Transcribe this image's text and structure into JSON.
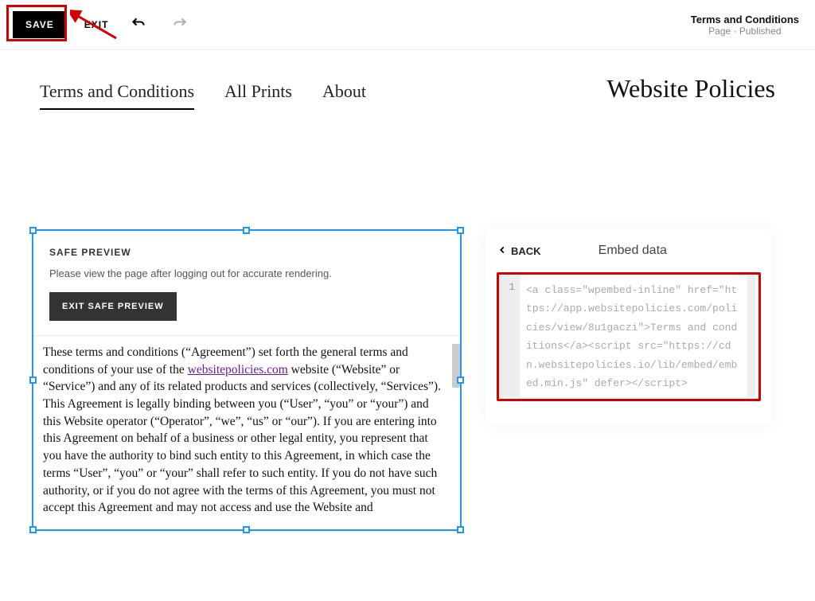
{
  "topbar": {
    "save_label": "SAVE",
    "exit_label": "EXIT",
    "doc_title": "Terms and Conditions",
    "doc_status": "Page · Published"
  },
  "nav": {
    "tabs": [
      {
        "label": "Terms and Conditions",
        "active": true
      },
      {
        "label": "All Prints",
        "active": false
      },
      {
        "label": "About",
        "active": false
      }
    ],
    "site_title": "Website Policies"
  },
  "preview": {
    "safe_title": "SAFE PREVIEW",
    "safe_text": "Please view the page after logging out for accurate rendering.",
    "exit_safe_label": "EXIT SAFE PREVIEW",
    "body_pre": "These terms and conditions (“Agreement”) set forth the general terms and conditions of your use of the ",
    "body_link": "websitepolicies.com",
    "body_post": " website (“Website” or “Service”) and any of its related products and services (collectively, “Services”). This Agreement is legally binding between you (“User”, “you” or “your”) and this Website operator (“Operator”, “we”, “us” or “our”). If you are entering into this Agreement on behalf of a business or other legal entity, you represent that you have the authority to bind such entity to this Agreement, in which case the terms “User”, “you” or “your” shall refer to such entity. If you do not have such authority, or if you do not agree with the terms of this Agreement, you must not accept this Agreement and may not access and use the Website and"
  },
  "sidebar": {
    "back_label": "BACK",
    "title": "Embed data",
    "code_line_number": "1",
    "code": "<a class=\"wpembed-inline\" href=\"https://app.websitepolicies.com/policies/view/8u1gaczi\">Terms and conditions</a><script src=\"https://cdn.websitepolicies.io/lib/embed/embed.min.js\" defer></script>"
  }
}
